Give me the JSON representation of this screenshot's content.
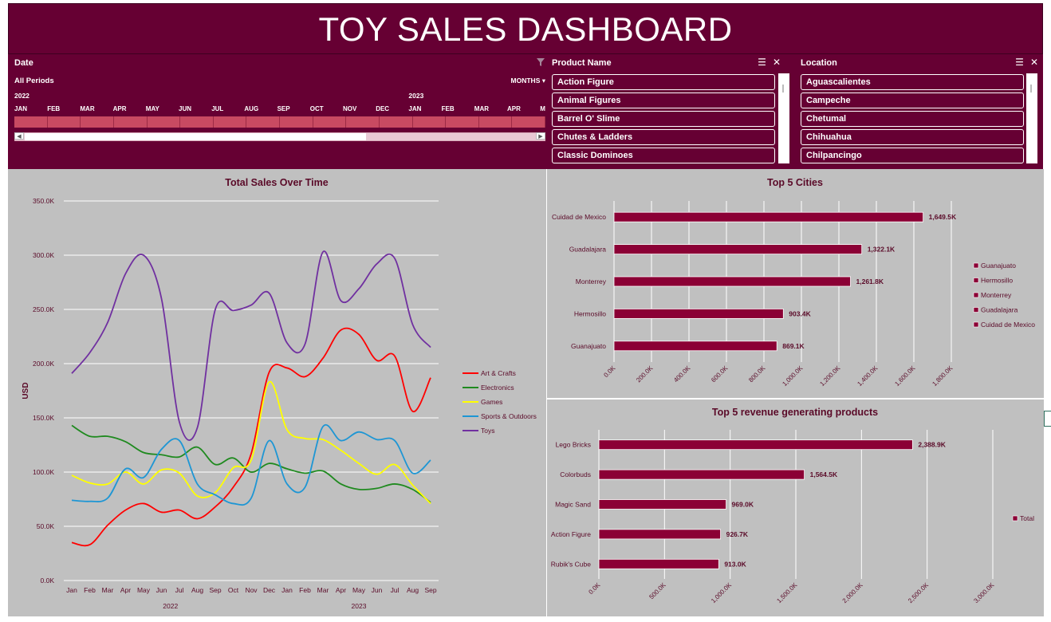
{
  "header": {
    "title": "TOY SALES DASHBOARD"
  },
  "timeline": {
    "title": "Date",
    "period_label": "All Periods",
    "level_label": "MONTHS ▾",
    "filter_icon": "clear-filter-icon",
    "years": [
      {
        "label": "2022",
        "month_index": 0
      },
      {
        "label": "2023",
        "month_index": 12
      }
    ],
    "months": [
      "JAN",
      "FEB",
      "MAR",
      "APR",
      "MAY",
      "JUN",
      "JUL",
      "AUG",
      "SEP",
      "OCT",
      "NOV",
      "DEC",
      "JAN",
      "FEB",
      "MAR",
      "APR",
      "M"
    ]
  },
  "product_slicer": {
    "title": "Product Name",
    "items": [
      "Action Figure",
      "Animal Figures",
      "Barrel O' Slime",
      "Chutes & Ladders",
      "Classic Dominoes"
    ]
  },
  "location_slicer": {
    "title": "Location",
    "items": [
      "Aguascalientes",
      "Campeche",
      "Chetumal",
      "Chihuahua",
      "Chilpancingo"
    ]
  },
  "colors": {
    "brand": "#660033",
    "bar": "#8b0035",
    "panel": "#c0c0c0",
    "art_crafts": "#ff0000",
    "electronics": "#1f8a1f",
    "games": "#ffff00",
    "sports_outdoors": "#1e96d4",
    "toys": "#7030a0"
  },
  "chart_data": [
    {
      "type": "line",
      "title": "Total Sales Over Time",
      "ylabel": "USD",
      "xlabel": "",
      "ylim": [
        0,
        350000
      ],
      "y_ticks": [
        "0.0K",
        "50.0K",
        "100.0K",
        "150.0K",
        "200.0K",
        "250.0K",
        "300.0K",
        "350.0K"
      ],
      "categories": [
        "Jan",
        "Feb",
        "Mar",
        "Apr",
        "May",
        "Jun",
        "Jul",
        "Aug",
        "Sep",
        "Oct",
        "Nov",
        "Dec",
        "Jan",
        "Feb",
        "Mar",
        "Apr",
        "May",
        "Jun",
        "Jul",
        "Aug",
        "Sep"
      ],
      "year_labels": [
        "2022",
        "2023"
      ],
      "grid": true,
      "legend_position": "right",
      "series": [
        {
          "name": "Art & Crafts",
          "color": "#ff0000",
          "values": [
            35000,
            33000,
            51000,
            65000,
            71000,
            63000,
            65000,
            57000,
            68000,
            86000,
            117000,
            192000,
            196000,
            188000,
            205000,
            231000,
            227000,
            203000,
            207000,
            156000,
            187000
          ]
        },
        {
          "name": "Electronics",
          "color": "#1f8a1f",
          "values": [
            143000,
            133000,
            133000,
            128000,
            118000,
            116000,
            114000,
            123000,
            107000,
            113000,
            100000,
            108000,
            103000,
            99000,
            101000,
            89000,
            84000,
            85000,
            89000,
            84000,
            72000
          ]
        },
        {
          "name": "Games",
          "color": "#ffff00",
          "values": [
            97000,
            90000,
            89000,
            100000,
            89000,
            102000,
            99000,
            78000,
            81000,
            104000,
            111000,
            183000,
            139000,
            131000,
            130000,
            120000,
            108000,
            98000,
            107000,
            88000,
            71000
          ]
        },
        {
          "name": "Sports & Outdoors",
          "color": "#1e96d4",
          "values": [
            74000,
            73000,
            76000,
            103000,
            95000,
            121000,
            129000,
            89000,
            79000,
            71000,
            76000,
            129000,
            89000,
            86000,
            142000,
            129000,
            137000,
            130000,
            129000,
            99000,
            111000
          ]
        },
        {
          "name": "Toys",
          "color": "#7030a0",
          "values": [
            191000,
            210000,
            238000,
            283000,
            300000,
            260000,
            146000,
            141000,
            250000,
            249000,
            254000,
            265000,
            219000,
            218000,
            303000,
            258000,
            269000,
            292000,
            297000,
            236000,
            215000
          ]
        }
      ]
    },
    {
      "type": "bar",
      "orientation": "horizontal",
      "title": "Top 5 Cities",
      "categories": [
        "Cuidad de Mexico",
        "Guadalajara",
        "Monterrey",
        "Hermosillo",
        "Guanajuato"
      ],
      "values": [
        1649500,
        1322100,
        1261800,
        903400,
        869100
      ],
      "data_labels": [
        "1,649.5K",
        "1,322.1K",
        "1,261.8K",
        "903.4K",
        "869.1K"
      ],
      "xlim": [
        0,
        1800000
      ],
      "x_ticks": [
        "0.0K",
        "200.0K",
        "400.0K",
        "600.0K",
        "800.0K",
        "1,000.0K",
        "1,200.0K",
        "1,400.0K",
        "1,600.0K",
        "1,800.0K"
      ],
      "legend": [
        "Guanajuato",
        "Hermosillo",
        "Monterrey",
        "Guadalajara",
        "Cuidad de Mexico"
      ],
      "legend_position": "right",
      "grid": true
    },
    {
      "type": "bar",
      "orientation": "horizontal",
      "title": "Top 5 revenue generating products",
      "categories": [
        "Lego Bricks",
        "Colorbuds",
        "Magic Sand",
        "Action Figure",
        "Rubik's Cube"
      ],
      "values": [
        2388900,
        1564500,
        969000,
        926700,
        913000
      ],
      "data_labels": [
        "2,388.9K",
        "1,564.5K",
        "969.0K",
        "926.7K",
        "913.0K"
      ],
      "xlim": [
        0,
        3000000
      ],
      "x_ticks": [
        "0.0K",
        "500.0K",
        "1,000.0K",
        "1,500.0K",
        "2,000.0K",
        "2,500.0K",
        "3,000.0K"
      ],
      "legend": [
        "Total"
      ],
      "legend_position": "right",
      "grid": true
    }
  ]
}
